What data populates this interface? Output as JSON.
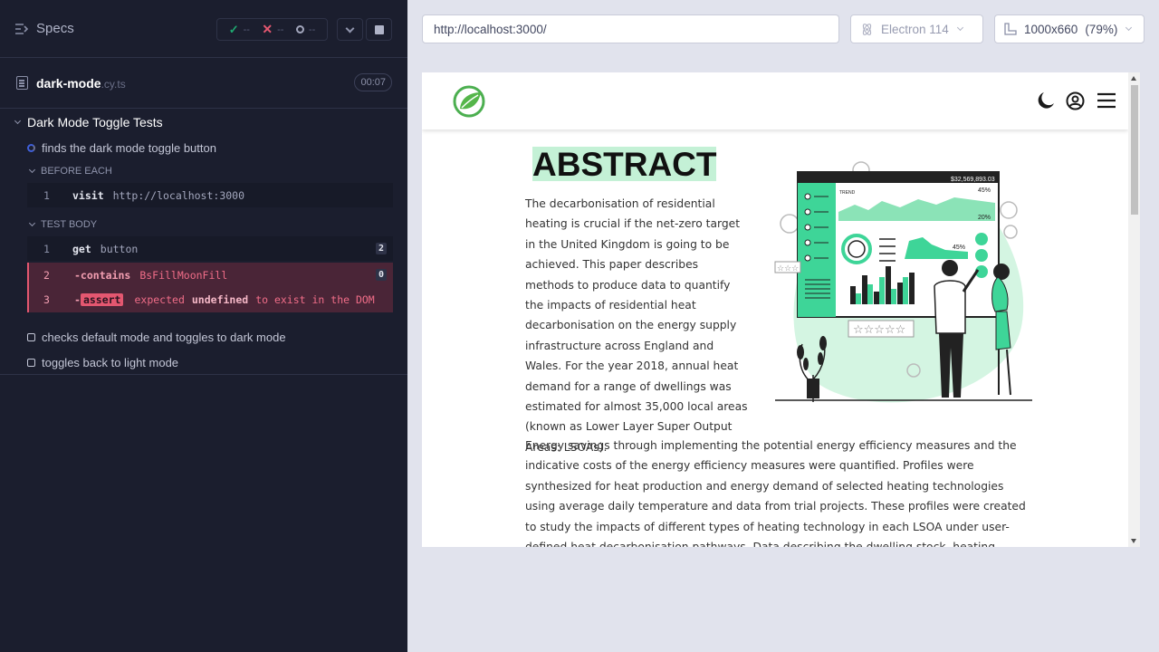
{
  "left": {
    "title": "Specs",
    "stats": {
      "passed": "--",
      "failed": "--",
      "pending": "--"
    },
    "spec": {
      "name": "dark-mode",
      "ext": ".cy.ts",
      "duration": "00:07"
    },
    "suite": "Dark Mode Toggle Tests",
    "tests": [
      {
        "title": "finds the dark mode toggle button",
        "state": "running"
      },
      {
        "title": "checks default mode and toggles to dark mode",
        "state": "pending"
      },
      {
        "title": "toggles back to light mode",
        "state": "pending"
      }
    ],
    "before_each": {
      "label": "BEFORE EACH",
      "commands": [
        {
          "num": "1",
          "name": "visit",
          "arg": "http://localhost:3000"
        }
      ]
    },
    "test_body": {
      "label": "TEST BODY",
      "commands": [
        {
          "num": "1",
          "name": "get",
          "arg": "button",
          "count": "2"
        },
        {
          "num": "2",
          "name": "-contains",
          "arg": "BsFillMoonFill",
          "count": "0"
        },
        {
          "num": "3",
          "prefix": "-",
          "name": "assert",
          "parts": [
            "expected",
            "undefined",
            "to exist in the DOM"
          ]
        }
      ]
    }
  },
  "browser": {
    "url": "http://localhost:3000/",
    "engine": "Electron 114",
    "viewport": "1000x660",
    "viewport_label": "1000x660",
    "zoom": "(79%)",
    "page": {
      "heading": "ABSTRACT",
      "para1": "The decarbonisation of residential heating is crucial if the net-zero target in the United Kingdom is going to be achieved. This paper describes methods to produce data to quantify the impacts of residential heat decarbonisation on the energy supply infrastructure across England and Wales. For the year 2018, annual heat demand for a range of dwellings was estimated for almost 35,000 local areas (known as Lower Layer Super Output Areas: LSOAs).",
      "para2": "Energy savings through implementing the potential energy efficiency measures and the indicative costs of the energy efficiency measures were quantified. Profiles were synthesized for heat production and energy demand of selected heating technologies using average daily temperature and data from trial projects. These profiles were created to study the impacts of different types of heating technology in each LSOA under user-defined heat decarbonisation pathways. Data describing the dwelling stock, heating technologies, annual",
      "dashboard_value": "$32,569,893.03",
      "dashboard_pct1": "45%",
      "dashboard_pct2": "20%",
      "dashboard_pct3": "45%",
      "trend_label": "TREND"
    }
  },
  "colors": {
    "accent_green": "#c4f1d6",
    "fail_red": "#e45770",
    "panel_bg": "#1b1e2e"
  }
}
